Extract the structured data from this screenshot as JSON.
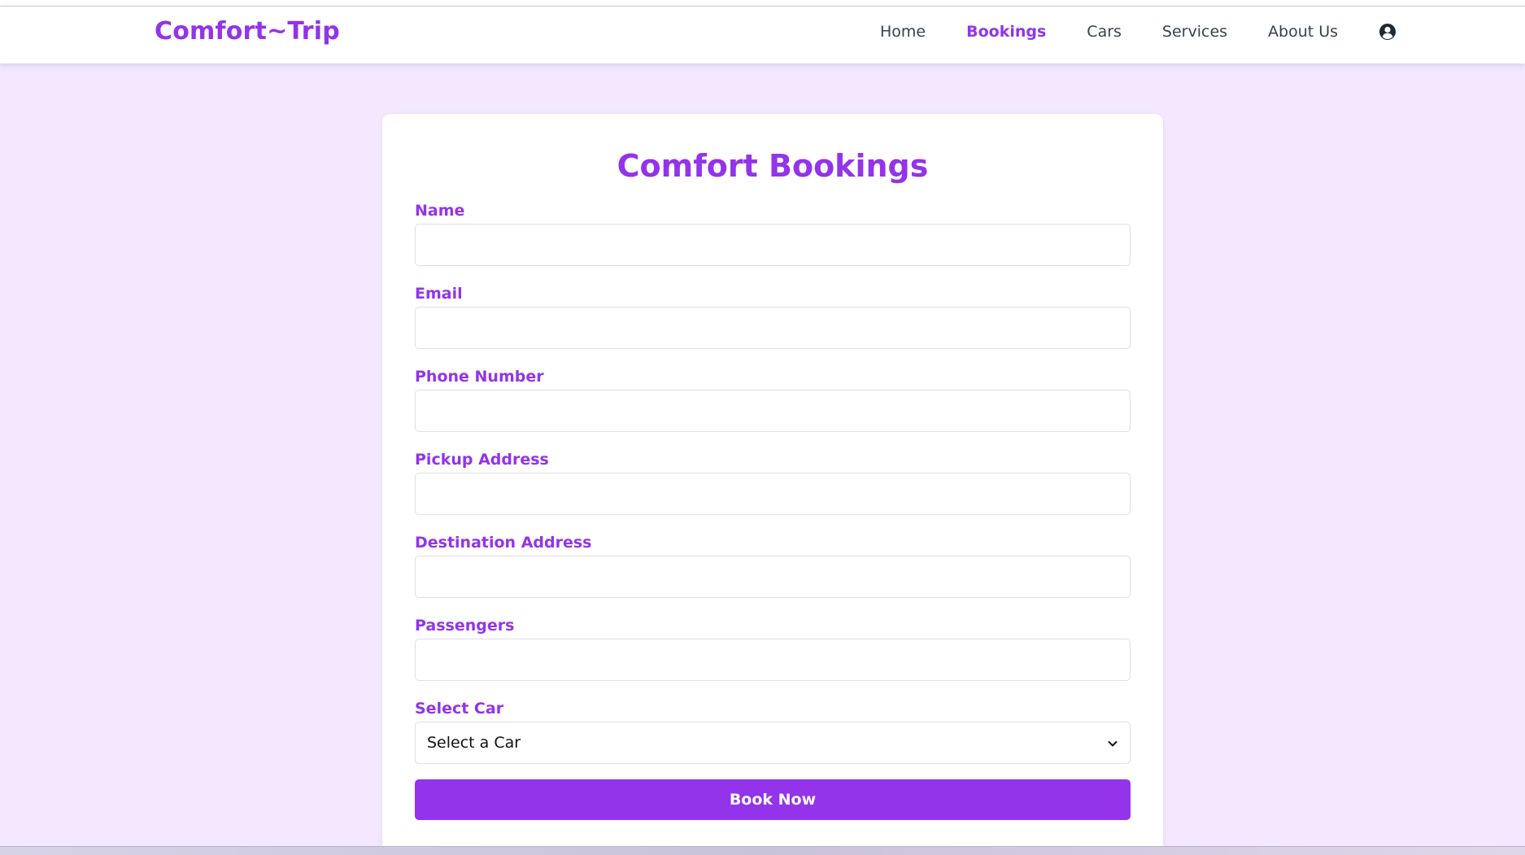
{
  "brand": {
    "name": "Comfort~Trip"
  },
  "nav": {
    "items": [
      {
        "label": "Home",
        "active": false
      },
      {
        "label": "Bookings",
        "active": true
      },
      {
        "label": "Cars",
        "active": false
      },
      {
        "label": "Services",
        "active": false
      },
      {
        "label": "About Us",
        "active": false
      }
    ],
    "user_icon": "user-circle-icon"
  },
  "form": {
    "title": "Comfort Bookings",
    "fields": {
      "name": {
        "label": "Name",
        "value": ""
      },
      "email": {
        "label": "Email",
        "value": ""
      },
      "phone": {
        "label": "Phone Number",
        "value": ""
      },
      "pickup": {
        "label": "Pickup Address",
        "value": ""
      },
      "destination": {
        "label": "Destination Address",
        "value": ""
      },
      "passengers": {
        "label": "Passengers",
        "value": ""
      },
      "car": {
        "label": "Select Car",
        "selected": "Select a Car"
      }
    },
    "submit_label": "Book Now"
  },
  "colors": {
    "accent": "#9333ea",
    "background": "#f3e8ff",
    "nav_text": "#374151"
  }
}
